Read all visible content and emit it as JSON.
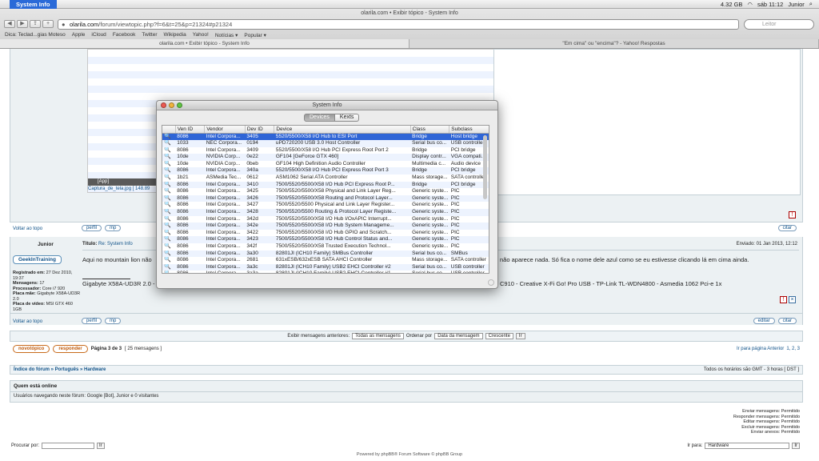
{
  "menubar": {
    "app": "System Info",
    "memory": "4.32 GB",
    "clock": "sáb 11:12",
    "user": "Junior"
  },
  "browser": {
    "window_title": "olarila.com • Exibir tópico - System Info",
    "url_host": "olarila.com",
    "url_path": "/forum/viewtopic.php?f=6&t=25&p=21324#p21324",
    "search_placeholder": "Leitor",
    "bookmarks": [
      "Dica: Teclad...gias Moteso",
      "Apple",
      "iCloud",
      "Facebook",
      "Twitter",
      "Wikipedia",
      "Yahoo!",
      "Notícias ▾",
      "Popular ▾"
    ],
    "tabs": [
      "olarila.com • Exibir tópico - System Info",
      "\"Em cima\" ou \"encima\"? - Yahoo! Respostas"
    ]
  },
  "forum": {
    "attachment_label": "Captura_de_tela.jpg [ 148.89",
    "attachment_app": "[App]",
    "back_to_top": "Voltar ao topo",
    "profile_btn": "perfil",
    "pm_btn": "mp",
    "quote_btn": "citar",
    "edit_btn": "editar",
    "author": "Junior",
    "post_title_prefix": "Título:",
    "post_title": "Re: System Info",
    "posted_date": "Enviado: 01 Jan 2013, 12:12",
    "username_badge": "GeekInTraining",
    "post_text_left": "Aqui no mountain lion não",
    "post_text_right": "não aparece nada. Só fica o nome dele azul como se eu estivesse clicando lá em cima ainda.",
    "signature_left": "Gigabyte X58A-UD3R 2.0 -",
    "signature_right": "C910 - Creative X-Fi Go! Pro USB - TP-Link TL-WDN4800 - Asmedia 1062 Pci-e 1x",
    "user_info": [
      {
        "label": "Registrado em:",
        "value": "27 Dez 2010, 19:37"
      },
      {
        "label": "Mensagens:",
        "value": "17"
      },
      {
        "label": "Processador:",
        "value": "Core i7 920"
      },
      {
        "label": "Placa mãe:",
        "value": "Gigabyte X58A-UD3R 2.0"
      },
      {
        "label": "Placa de vídeo:",
        "value": "MSI GTX 460 1GB"
      }
    ],
    "sort_label": "Exibir mensagens anteriores:",
    "sort_all": "Todas as mensagens",
    "sort_order_label": "Ordenar por",
    "sort_by": "Data da mensagem",
    "sort_dir": "Crescente",
    "go_btn": "Ir",
    "new_topic_btn": "novotópico",
    "reply_btn": "responder",
    "pagination": "Página 3 de 3",
    "message_count": "[ 25 mensagens ]",
    "goto_prev": "Ir para página Anterior",
    "pages": "1, 2, 3",
    "breadcrumb": "Índice do fórum » Português » Hardware",
    "timezone": "Todos os horários são GMT - 3 horas [ DST ]",
    "online_title": "Quem está online",
    "online_text": "Usuários navegando neste fórum: Google [Bot], Junior e 0 visitantes",
    "permissions": [
      "Enviar mensagens: Permitido",
      "Responder mensagens: Permitido",
      "Editar mensagens: Permitido",
      "Excluir mensagens: Permitido",
      "Enviar anexos: Permitido"
    ],
    "search_label": "Procurar por:",
    "jump_label": "Ir para:",
    "jump_value": "Hardware",
    "footer": "Powered by phpBB® Forum Software © phpBB Group"
  },
  "sysinfo": {
    "title": "System Info",
    "tab_devices": "Devices",
    "tab_kexts": "Kexts",
    "columns": [
      "Ven ID",
      "Vendor",
      "Dev ID",
      "Device",
      "Class",
      "Subclass"
    ],
    "rows": [
      [
        "8086",
        "Intel Corpora...",
        "3405",
        "5520/5500/X58 I/O Hub to ESI Port",
        "Bridge",
        "Host bridge"
      ],
      [
        "1033",
        "NEC Corpora...",
        "0194",
        "uPD720200 USB 3.0 Host Controller",
        "Serial bus co...",
        "USB controller"
      ],
      [
        "8086",
        "Intel Corpora...",
        "3409",
        "5520/5500/X58 I/O Hub PCI Express Root Port 2",
        "Bridge",
        "PCI bridge"
      ],
      [
        "10de",
        "NVIDIA Corp...",
        "0e22",
        "GF104 [GeForce GTX 460]",
        "Display contr...",
        "VGA compati..."
      ],
      [
        "10de",
        "NVIDIA Corp...",
        "0beb",
        "GF104 High Definition Audio Controller",
        "Multimedia c...",
        "Audio device"
      ],
      [
        "8086",
        "Intel Corpora...",
        "340a",
        "5520/5500/X58 I/O Hub PCI Express Root Port 3",
        "Bridge",
        "PCI bridge"
      ],
      [
        "1b21",
        "ASMedia Tec...",
        "0612",
        "ASM1062 Serial ATA Controller",
        "Mass storage...",
        "SATA controller"
      ],
      [
        "8086",
        "Intel Corpora...",
        "3410",
        "7500/5520/5500/X58 I/O Hub PCI Express Root P...",
        "Bridge",
        "PCI bridge"
      ],
      [
        "8086",
        "Intel Corpora...",
        "3425",
        "7500/5520/5500/X58 Physical and Link Layer Reg...",
        "Generic syste...",
        "PIC"
      ],
      [
        "8086",
        "Intel Corpora...",
        "3426",
        "7500/5520/5500/X58 Routing and Protocol Layer...",
        "Generic syste...",
        "PIC"
      ],
      [
        "8086",
        "Intel Corpora...",
        "3427",
        "7500/5520/5500 Physical and Link Layer Register...",
        "Generic syste...",
        "PIC"
      ],
      [
        "8086",
        "Intel Corpora...",
        "3428",
        "7500/5520/5500 Routing & Protocol Layer Registe...",
        "Generic syste...",
        "PIC"
      ],
      [
        "8086",
        "Intel Corpora...",
        "342d",
        "7500/5520/5500/X58 I/O Hub I/OxAPIC Interrupt...",
        "Generic syste...",
        "PIC"
      ],
      [
        "8086",
        "Intel Corpora...",
        "342e",
        "7500/5520/5500/X58 I/O Hub System Manageme...",
        "Generic syste...",
        "PIC"
      ],
      [
        "8086",
        "Intel Corpora...",
        "3422",
        "7500/5520/5500/X58 I/O Hub GPIO and Scratch...",
        "Generic syste...",
        "PIC"
      ],
      [
        "8086",
        "Intel Corpora...",
        "3423",
        "7500/5520/5500/X58 I/O Hub Control Status and...",
        "Generic syste...",
        "PIC"
      ],
      [
        "8086",
        "Intel Corpora...",
        "342f",
        "7500/5520/5500/X58 Trusted Execution Technol...",
        "Generic syste...",
        "PIC"
      ],
      [
        "8086",
        "Intel Corpora...",
        "3a30",
        "82801JI (ICH10 Family) SMBus Controller",
        "Serial bus co...",
        "SMBus"
      ],
      [
        "8086",
        "Intel Corpora...",
        "2681",
        "631xESB/632xESB SATA AHCI Controller",
        "Mass storage...",
        "SATA controller"
      ],
      [
        "8086",
        "Intel Corpora...",
        "3a3c",
        "82801JI (ICH10 Family) USB2 EHCI Controller #2",
        "Serial bus co...",
        "USB controller"
      ],
      [
        "8086",
        "Intel Corpora...",
        "3a3a",
        "82801JI (ICH10 Family) USB2 EHCI Controller #1",
        "Serial bus co...",
        "USB controller"
      ]
    ]
  }
}
